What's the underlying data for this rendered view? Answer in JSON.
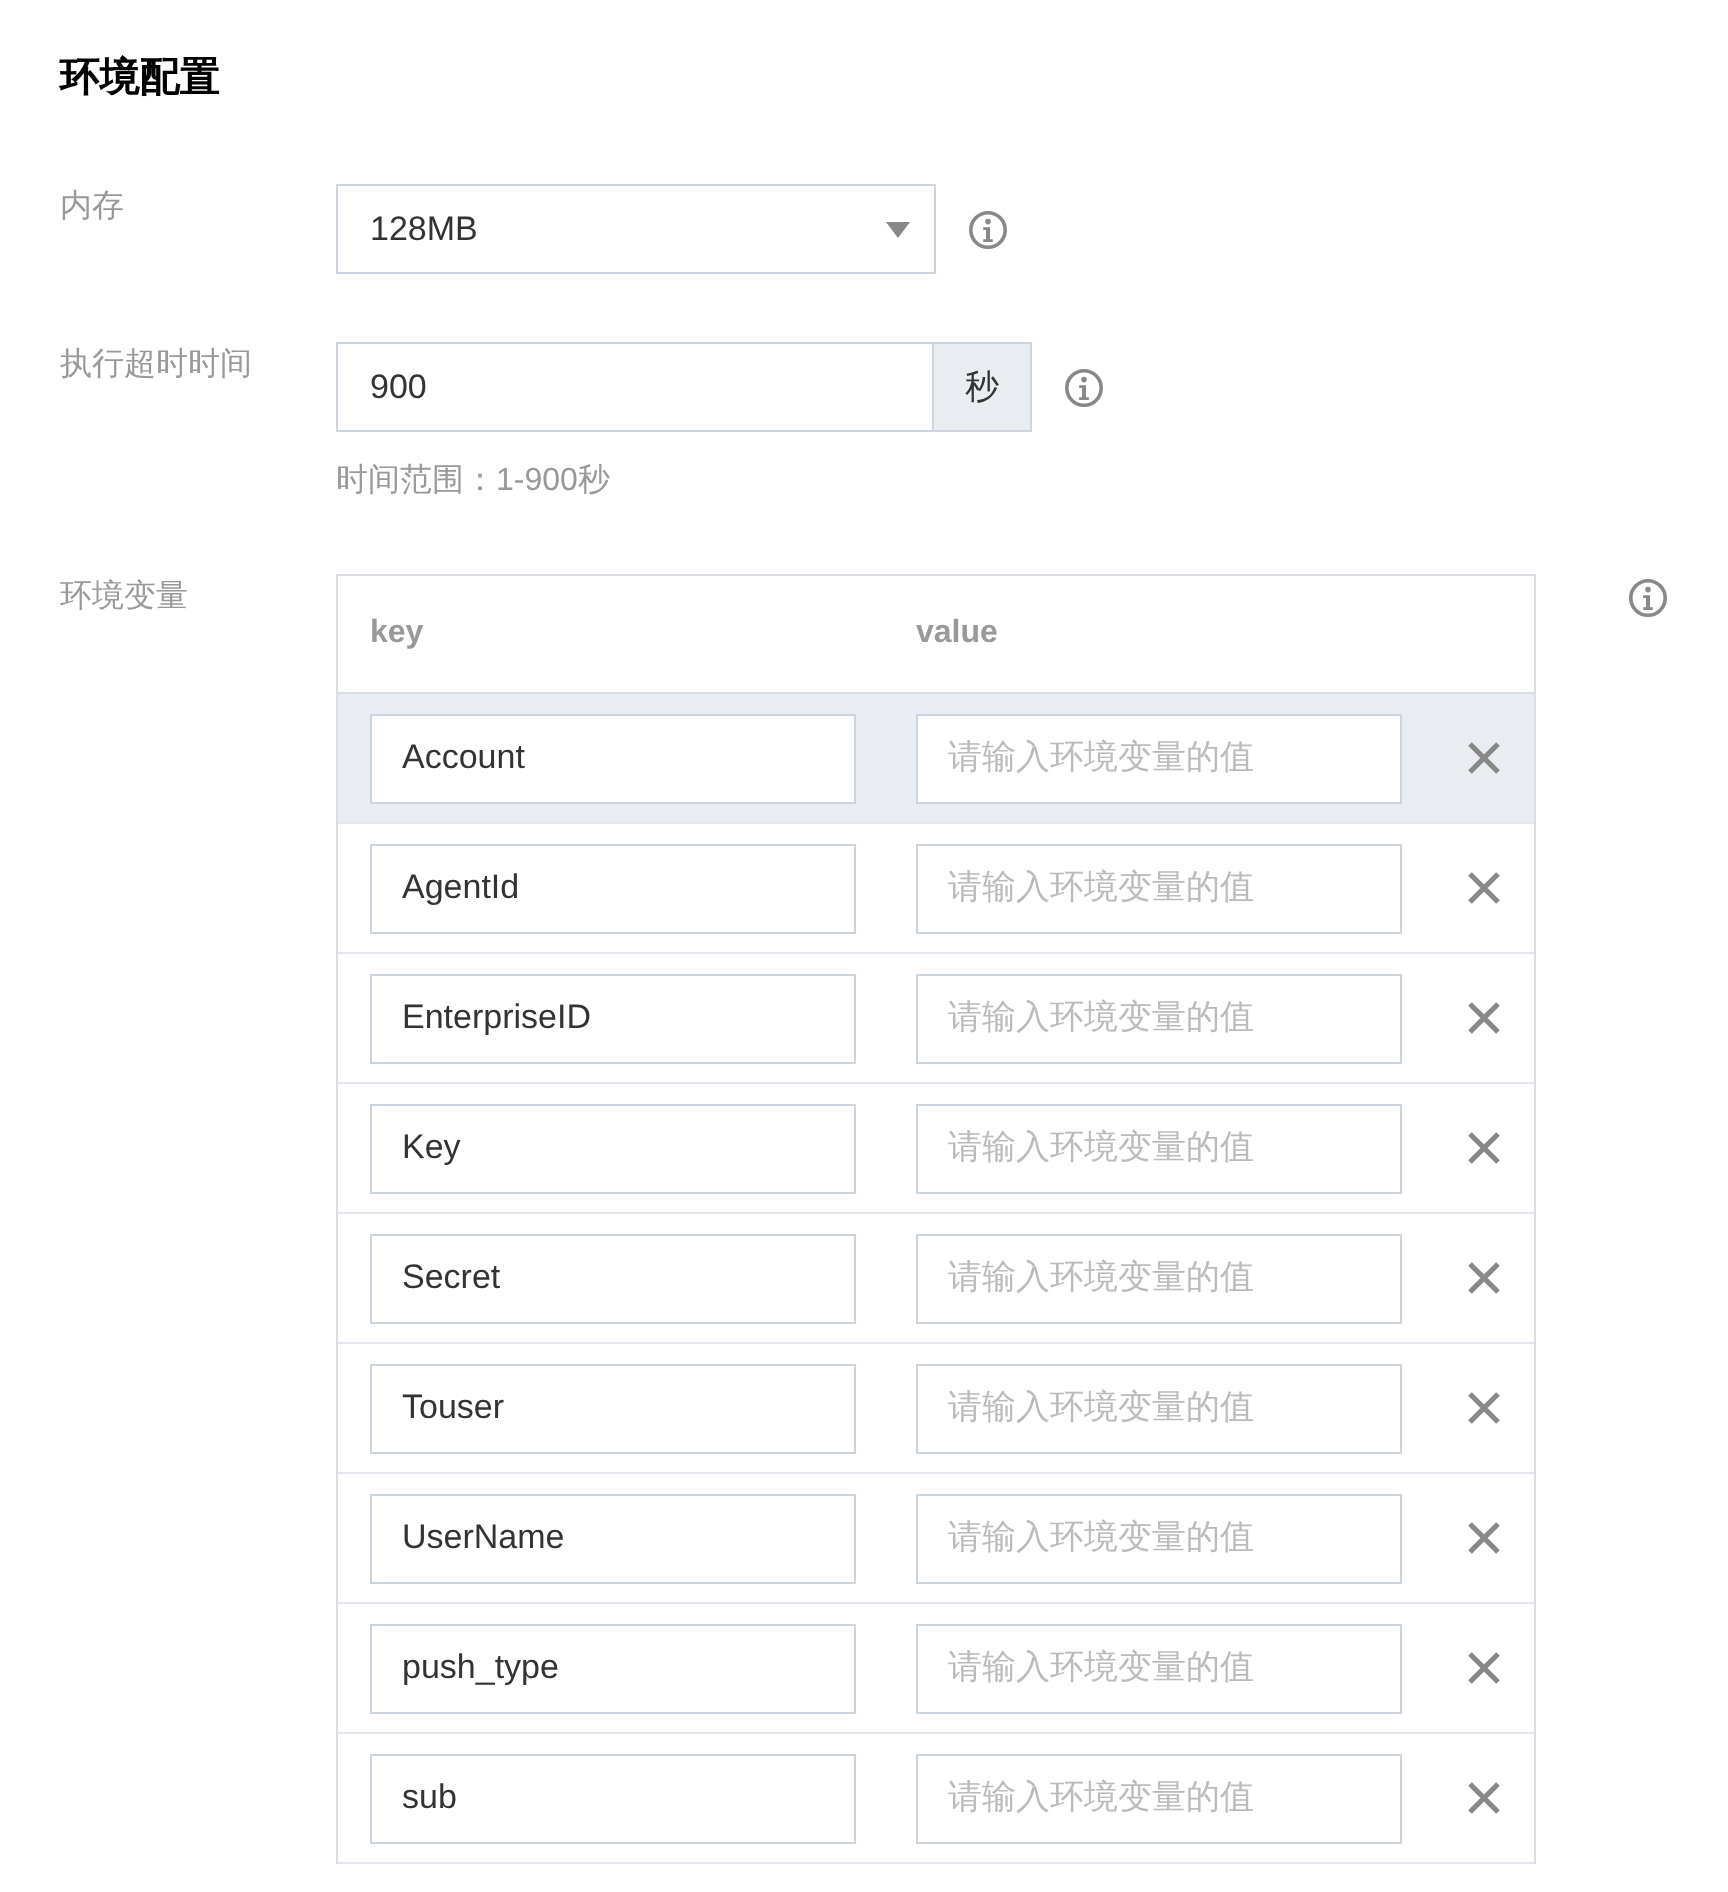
{
  "section_title": "环境配置",
  "memory": {
    "label": "内存",
    "value": "128MB"
  },
  "timeout": {
    "label": "执行超时时间",
    "value": "900",
    "unit": "秒",
    "hint": "时间范围：1-900秒"
  },
  "env_vars": {
    "label": "环境变量",
    "columns": [
      "key",
      "value"
    ],
    "rows": [
      {
        "key": "Account",
        "placeholder": "请输入环境变量的值",
        "highlighted": true
      },
      {
        "key": "AgentId",
        "placeholder": "请输入环境变量的值",
        "highlighted": false
      },
      {
        "key": "EnterpriseID",
        "placeholder": "请输入环境变量的值",
        "highlighted": false
      },
      {
        "key": "Key",
        "placeholder": "请输入环境变量的值",
        "highlighted": false
      },
      {
        "key": "Secret",
        "placeholder": "请输入环境变量的值",
        "highlighted": false
      },
      {
        "key": "Touser",
        "placeholder": "请输入环境变量的值",
        "highlighted": false
      },
      {
        "key": "UserName",
        "placeholder": "请输入环境变量的值",
        "highlighted": false
      },
      {
        "key": "push_type",
        "placeholder": "请输入环境变量的值",
        "highlighted": false
      },
      {
        "key": "sub",
        "placeholder": "请输入环境变量的值",
        "highlighted": false
      }
    ]
  }
}
